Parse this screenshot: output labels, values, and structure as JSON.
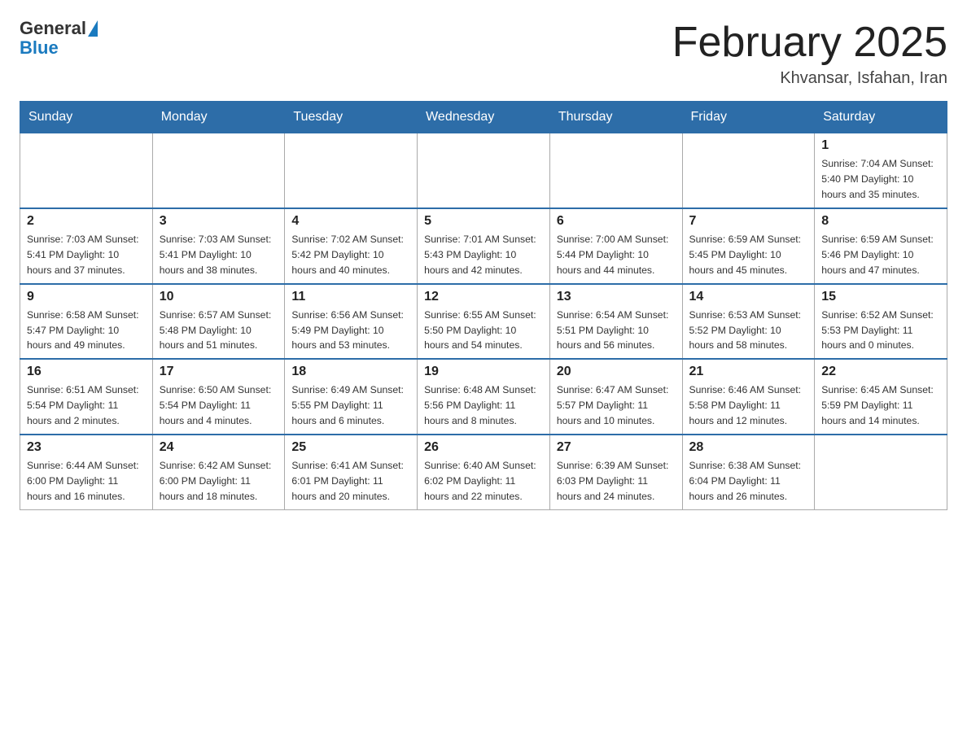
{
  "header": {
    "title": "February 2025",
    "location": "Khvansar, Isfahan, Iran",
    "logo_general": "General",
    "logo_blue": "Blue"
  },
  "days_of_week": [
    "Sunday",
    "Monday",
    "Tuesday",
    "Wednesday",
    "Thursday",
    "Friday",
    "Saturday"
  ],
  "weeks": [
    [
      {
        "day": "",
        "info": ""
      },
      {
        "day": "",
        "info": ""
      },
      {
        "day": "",
        "info": ""
      },
      {
        "day": "",
        "info": ""
      },
      {
        "day": "",
        "info": ""
      },
      {
        "day": "",
        "info": ""
      },
      {
        "day": "1",
        "info": "Sunrise: 7:04 AM\nSunset: 5:40 PM\nDaylight: 10 hours\nand 35 minutes."
      }
    ],
    [
      {
        "day": "2",
        "info": "Sunrise: 7:03 AM\nSunset: 5:41 PM\nDaylight: 10 hours\nand 37 minutes."
      },
      {
        "day": "3",
        "info": "Sunrise: 7:03 AM\nSunset: 5:41 PM\nDaylight: 10 hours\nand 38 minutes."
      },
      {
        "day": "4",
        "info": "Sunrise: 7:02 AM\nSunset: 5:42 PM\nDaylight: 10 hours\nand 40 minutes."
      },
      {
        "day": "5",
        "info": "Sunrise: 7:01 AM\nSunset: 5:43 PM\nDaylight: 10 hours\nand 42 minutes."
      },
      {
        "day": "6",
        "info": "Sunrise: 7:00 AM\nSunset: 5:44 PM\nDaylight: 10 hours\nand 44 minutes."
      },
      {
        "day": "7",
        "info": "Sunrise: 6:59 AM\nSunset: 5:45 PM\nDaylight: 10 hours\nand 45 minutes."
      },
      {
        "day": "8",
        "info": "Sunrise: 6:59 AM\nSunset: 5:46 PM\nDaylight: 10 hours\nand 47 minutes."
      }
    ],
    [
      {
        "day": "9",
        "info": "Sunrise: 6:58 AM\nSunset: 5:47 PM\nDaylight: 10 hours\nand 49 minutes."
      },
      {
        "day": "10",
        "info": "Sunrise: 6:57 AM\nSunset: 5:48 PM\nDaylight: 10 hours\nand 51 minutes."
      },
      {
        "day": "11",
        "info": "Sunrise: 6:56 AM\nSunset: 5:49 PM\nDaylight: 10 hours\nand 53 minutes."
      },
      {
        "day": "12",
        "info": "Sunrise: 6:55 AM\nSunset: 5:50 PM\nDaylight: 10 hours\nand 54 minutes."
      },
      {
        "day": "13",
        "info": "Sunrise: 6:54 AM\nSunset: 5:51 PM\nDaylight: 10 hours\nand 56 minutes."
      },
      {
        "day": "14",
        "info": "Sunrise: 6:53 AM\nSunset: 5:52 PM\nDaylight: 10 hours\nand 58 minutes."
      },
      {
        "day": "15",
        "info": "Sunrise: 6:52 AM\nSunset: 5:53 PM\nDaylight: 11 hours\nand 0 minutes."
      }
    ],
    [
      {
        "day": "16",
        "info": "Sunrise: 6:51 AM\nSunset: 5:54 PM\nDaylight: 11 hours\nand 2 minutes."
      },
      {
        "day": "17",
        "info": "Sunrise: 6:50 AM\nSunset: 5:54 PM\nDaylight: 11 hours\nand 4 minutes."
      },
      {
        "day": "18",
        "info": "Sunrise: 6:49 AM\nSunset: 5:55 PM\nDaylight: 11 hours\nand 6 minutes."
      },
      {
        "day": "19",
        "info": "Sunrise: 6:48 AM\nSunset: 5:56 PM\nDaylight: 11 hours\nand 8 minutes."
      },
      {
        "day": "20",
        "info": "Sunrise: 6:47 AM\nSunset: 5:57 PM\nDaylight: 11 hours\nand 10 minutes."
      },
      {
        "day": "21",
        "info": "Sunrise: 6:46 AM\nSunset: 5:58 PM\nDaylight: 11 hours\nand 12 minutes."
      },
      {
        "day": "22",
        "info": "Sunrise: 6:45 AM\nSunset: 5:59 PM\nDaylight: 11 hours\nand 14 minutes."
      }
    ],
    [
      {
        "day": "23",
        "info": "Sunrise: 6:44 AM\nSunset: 6:00 PM\nDaylight: 11 hours\nand 16 minutes."
      },
      {
        "day": "24",
        "info": "Sunrise: 6:42 AM\nSunset: 6:00 PM\nDaylight: 11 hours\nand 18 minutes."
      },
      {
        "day": "25",
        "info": "Sunrise: 6:41 AM\nSunset: 6:01 PM\nDaylight: 11 hours\nand 20 minutes."
      },
      {
        "day": "26",
        "info": "Sunrise: 6:40 AM\nSunset: 6:02 PM\nDaylight: 11 hours\nand 22 minutes."
      },
      {
        "day": "27",
        "info": "Sunrise: 6:39 AM\nSunset: 6:03 PM\nDaylight: 11 hours\nand 24 minutes."
      },
      {
        "day": "28",
        "info": "Sunrise: 6:38 AM\nSunset: 6:04 PM\nDaylight: 11 hours\nand 26 minutes."
      },
      {
        "day": "",
        "info": ""
      }
    ]
  ]
}
